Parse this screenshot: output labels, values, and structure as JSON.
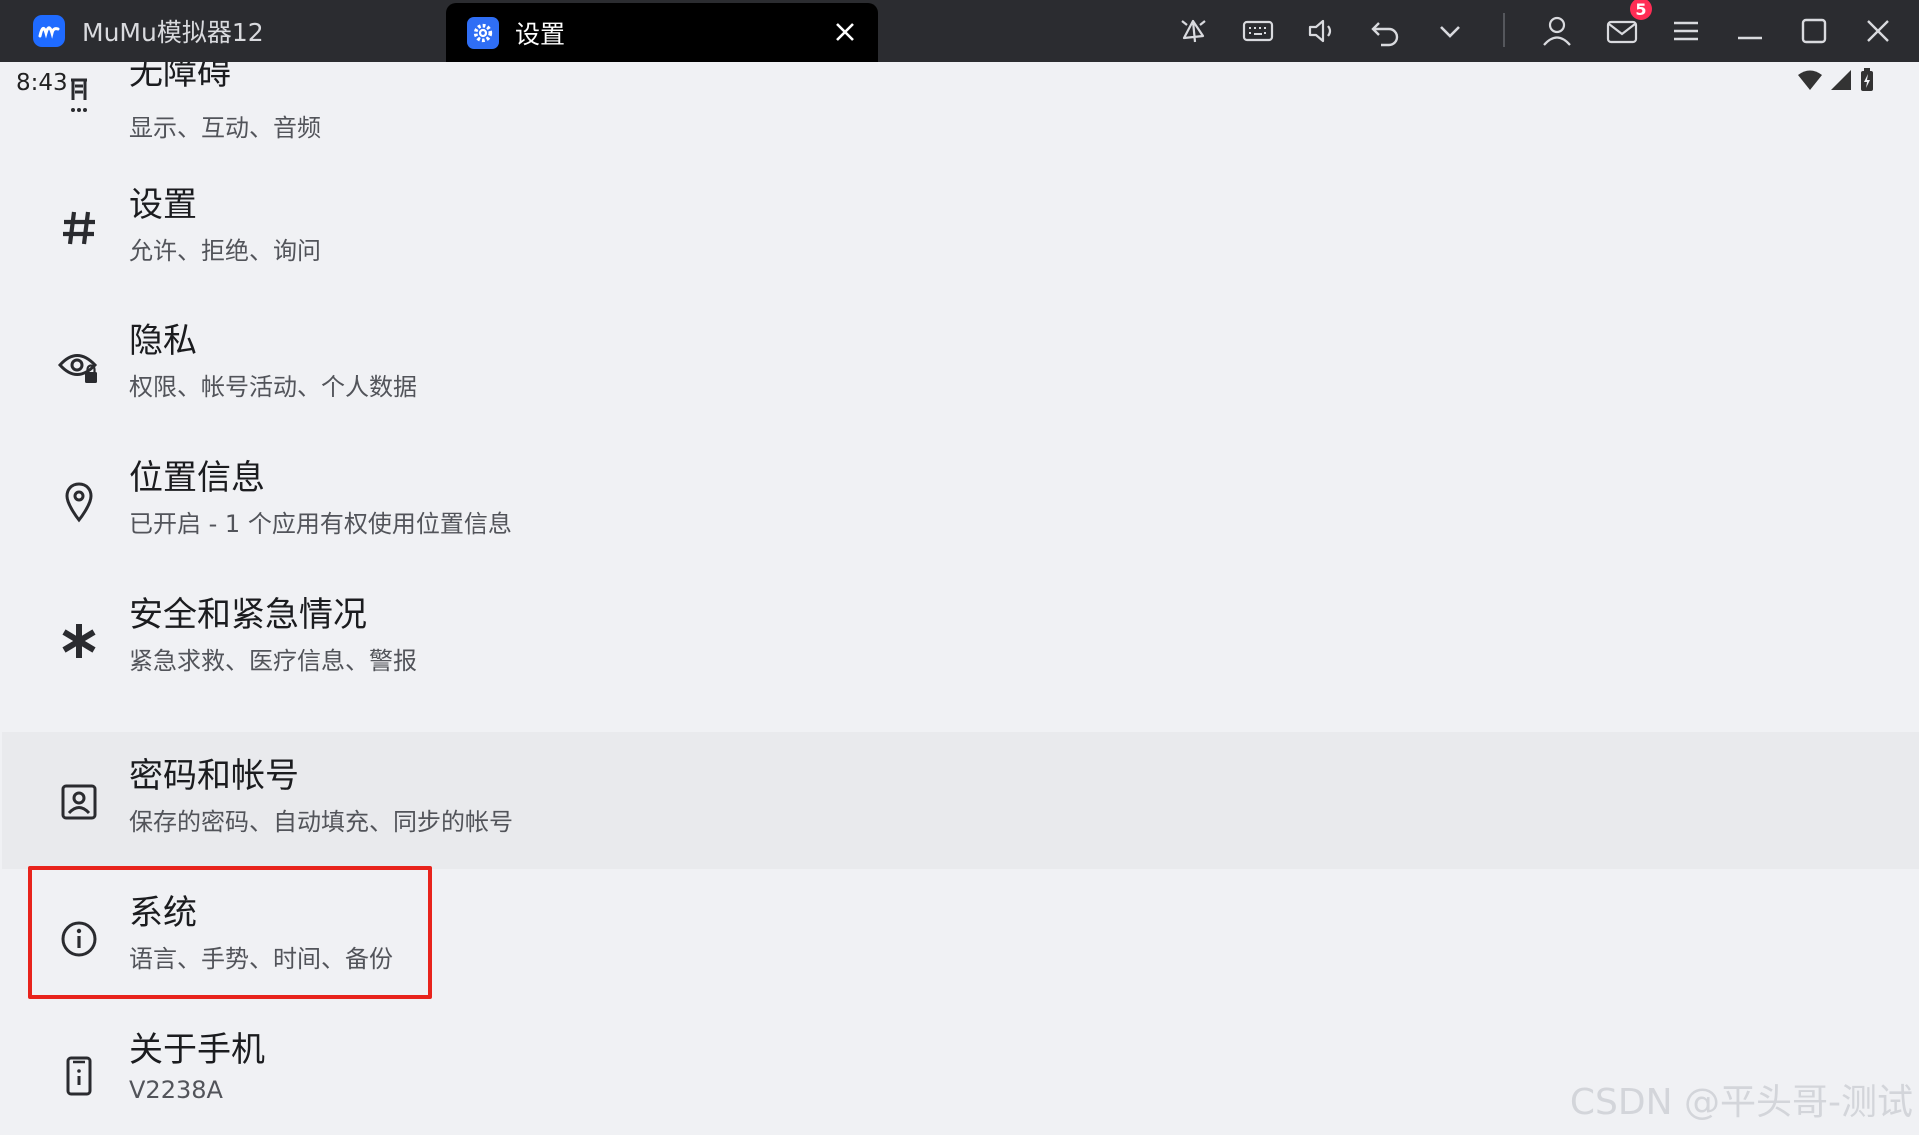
{
  "window": {
    "app_tab_title": "MuMu模拟器12",
    "active_tab_title": "设置",
    "mail_badge": "5"
  },
  "statusbar": {
    "time": "8:43"
  },
  "settings": [
    {
      "title": "无障碍",
      "subtitle": "显示、互动、音频",
      "icon": "accessibility-icon"
    },
    {
      "title": "设置",
      "subtitle": "允许、拒绝、询问",
      "icon": "hash-icon"
    },
    {
      "title": "隐私",
      "subtitle": "权限、帐号活动、个人数据",
      "icon": "eye-lock-icon"
    },
    {
      "title": "位置信息",
      "subtitle": "已开启 - 1 个应用有权使用位置信息",
      "icon": "location-pin-icon"
    },
    {
      "title": "安全和紧急情况",
      "subtitle": "紧急求救、医疗信息、警报",
      "icon": "asterisk-icon"
    },
    {
      "title": "密码和帐号",
      "subtitle": "保存的密码、自动填充、同步的帐号",
      "icon": "account-box-icon"
    },
    {
      "title": "系统",
      "subtitle": "语言、手势、时间、备份",
      "icon": "info-icon"
    },
    {
      "title": "关于手机",
      "subtitle": "V2238A",
      "icon": "phone-icon"
    }
  ],
  "watermark": "CSDN @平头哥-测试",
  "colors": {
    "titlebar": "#2b2c30",
    "highlight_box": "#e8231c",
    "background": "#f0f1f4"
  }
}
